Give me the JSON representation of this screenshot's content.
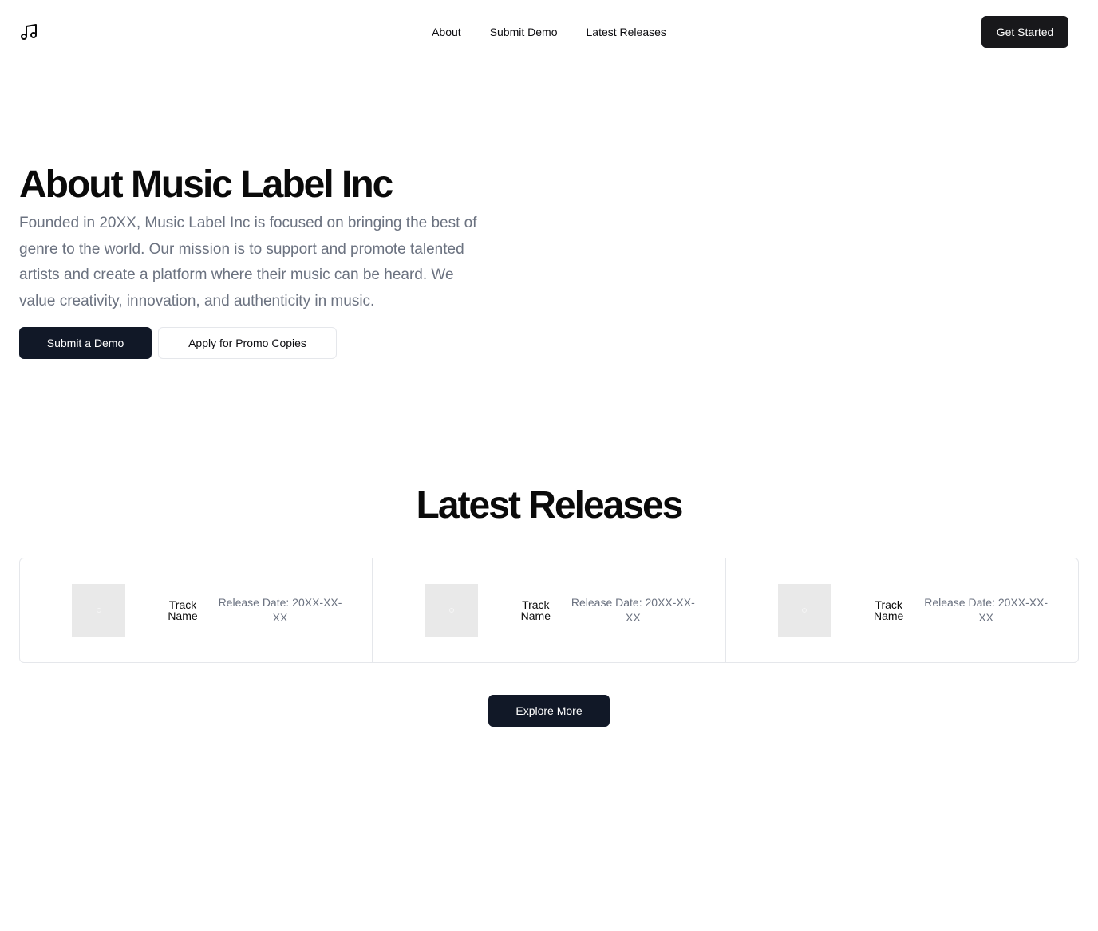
{
  "header": {
    "logo_icon": "music-note-icon",
    "nav": [
      {
        "label": "About"
      },
      {
        "label": "Submit Demo"
      },
      {
        "label": "Latest Releases"
      }
    ],
    "cta_label": "Get Started"
  },
  "hero": {
    "title": "About Music Label Inc",
    "description": "Founded in 20XX, Music Label Inc is focused on bringing the best of genre to the world. Our mission is to support and promote talented artists and create a platform where their music can be heard. We value creativity, innovation, and authenticity in music.",
    "primary_button": "Submit a Demo",
    "secondary_button": "Apply for Promo Copies"
  },
  "releases": {
    "title": "Latest Releases",
    "items": [
      {
        "track": "Track Name",
        "date": "Release Date: 20XX-XX-XX"
      },
      {
        "track": "Track Name",
        "date": "Release Date: 20XX-XX-XX"
      },
      {
        "track": "Track Name",
        "date": "Release Date: 20XX-XX-XX"
      }
    ],
    "explore_button": "Explore More"
  },
  "colors": {
    "primary_dark": "#111827",
    "muted_text": "#6b7280",
    "border": "#e5e7eb",
    "placeholder": "#e9e9e9"
  }
}
